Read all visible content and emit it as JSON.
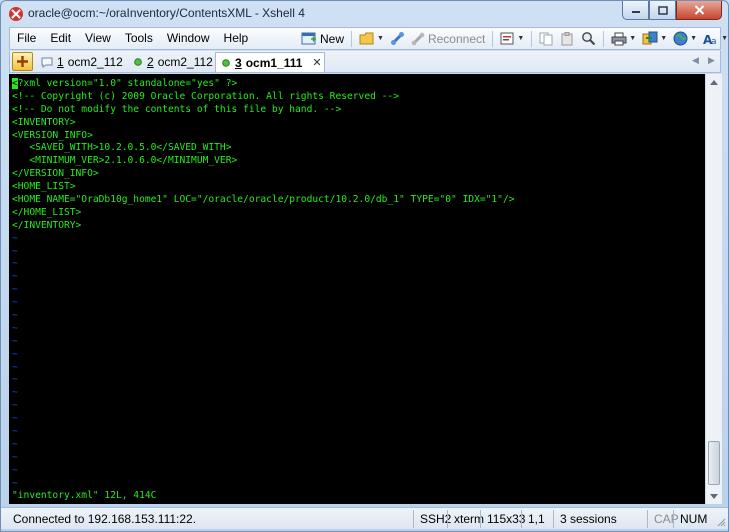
{
  "window": {
    "title": "oracle@ocm:~/oraInventory/ContentsXML - Xshell 4"
  },
  "menu": {
    "items": [
      "File",
      "Edit",
      "View",
      "Tools",
      "Window",
      "Help"
    ]
  },
  "toolbar": {
    "new_label": "New",
    "reconnect_label": "Reconnect"
  },
  "tabs": [
    {
      "num": "1",
      "label": "ocm2_112",
      "active": false
    },
    {
      "num": "2",
      "label": "ocm2_112",
      "active": false
    },
    {
      "num": "3",
      "label": "ocm1_111",
      "active": true
    }
  ],
  "terminal": {
    "first_char": "<",
    "first_rest": "?xml version=\"1.0\" standalone=\"yes\" ?>",
    "lines": [
      "<!-- Copyright (c) 2009 Oracle Corporation. All rights Reserved -->",
      "<!-- Do not modify the contents of this file by hand. -->",
      "<INVENTORY>",
      "<VERSION_INFO>",
      "   <SAVED_WITH>10.2.0.5.0</SAVED_WITH>",
      "   <MINIMUM_VER>2.1.0.6.0</MINIMUM_VER>",
      "</VERSION_INFO>",
      "<HOME_LIST>",
      "<HOME NAME=\"OraDb10g_home1\" LOC=\"/oracle/oracle/product/10.2.0/db_1\" TYPE=\"0\" IDX=\"1\"/>",
      "</HOME_LIST>",
      "</INVENTORY>"
    ],
    "tilde": "~",
    "tilde_count": 20,
    "status_line": "\"inventory.xml\" 12L, 414C"
  },
  "statusbar": {
    "connection": "Connected to 192.168.153.111:22.",
    "protocol": "SSH2",
    "term": "xterm",
    "size": "115x33",
    "cursor": "1,1",
    "sessions": "3 sessions",
    "cap": "CAP",
    "num": "NUM"
  },
  "colors": {
    "terminal_fg": "#23ee1a",
    "terminal_bg": "#000000",
    "tilde": "#0a4ee8"
  }
}
